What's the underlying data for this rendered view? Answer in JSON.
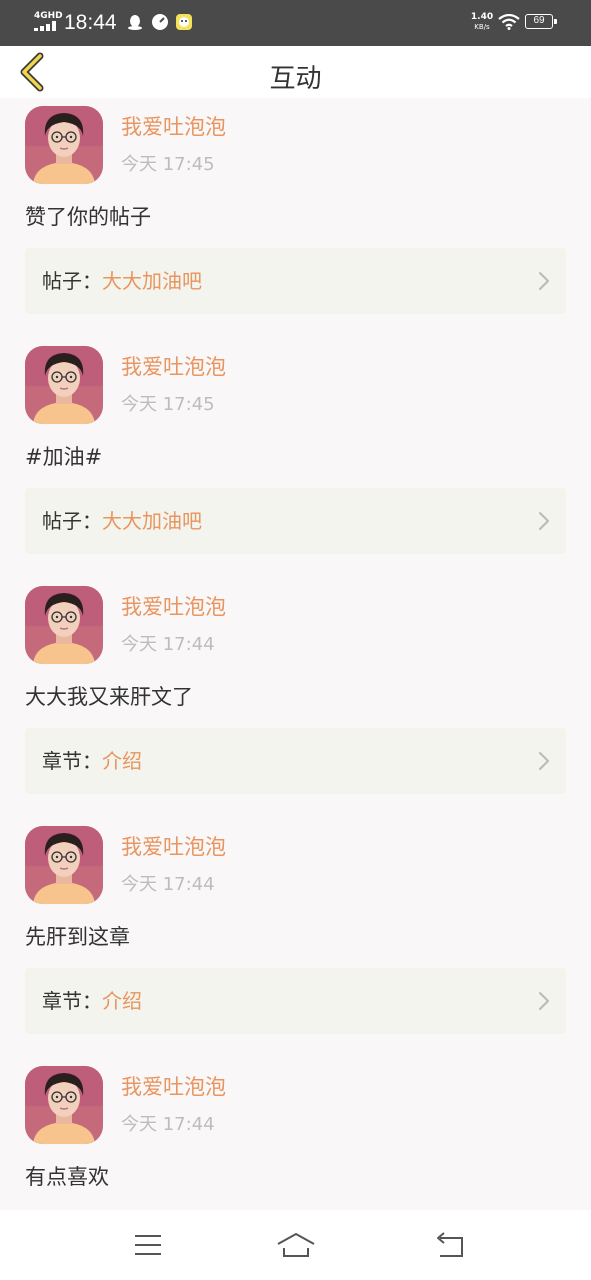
{
  "status_bar": {
    "network": "4GHD",
    "time": "18:44",
    "speed_value": "1.40",
    "speed_unit": "KB/s",
    "battery": "69"
  },
  "header": {
    "title": "互动"
  },
  "colors": {
    "accent": "#e8955f",
    "timestamp": "#bdbdbd",
    "card_bg": "#f4f4ee",
    "text": "#333333"
  },
  "feed": [
    {
      "user": "我爱吐泡泡",
      "time": "今天 17:45",
      "content": "赞了你的帖子",
      "ref_label": "帖子：",
      "ref_title": "大大加油吧"
    },
    {
      "user": "我爱吐泡泡",
      "time": "今天 17:45",
      "content": "#加油#",
      "ref_label": "帖子：",
      "ref_title": "大大加油吧"
    },
    {
      "user": "我爱吐泡泡",
      "time": "今天 17:44",
      "content": "大大我又来肝文了",
      "ref_label": "章节：",
      "ref_title": "介绍"
    },
    {
      "user": "我爱吐泡泡",
      "time": "今天 17:44",
      "content": "先肝到这章",
      "ref_label": "章节：",
      "ref_title": "介绍"
    },
    {
      "user": "我爱吐泡泡",
      "time": "今天 17:44",
      "content": "有点喜欢"
    }
  ],
  "nav": {
    "icons": [
      "menu-icon",
      "home-icon",
      "back-icon"
    ]
  }
}
